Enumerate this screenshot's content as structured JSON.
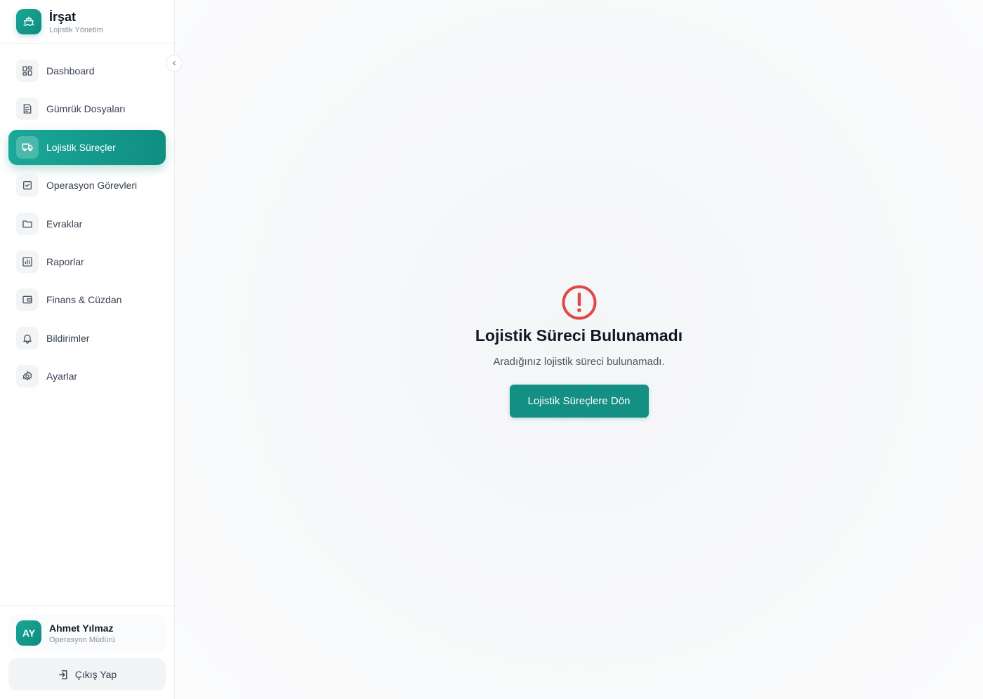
{
  "brand": {
    "name": "İrşat",
    "subtitle": "Lojistik Yönetim",
    "logo_icon": "ship-icon"
  },
  "sidebar": {
    "collapse_icon": "chevron-left-icon",
    "items": [
      {
        "label": "Dashboard",
        "icon": "grid-icon",
        "active": false
      },
      {
        "label": "Gümrük Dosyaları",
        "icon": "document-icon",
        "active": false
      },
      {
        "label": "Lojistik Süreçler",
        "icon": "truck-icon",
        "active": true
      },
      {
        "label": "Operasyon Görevleri",
        "icon": "checkbox-icon",
        "active": false
      },
      {
        "label": "Evraklar",
        "icon": "folder-icon",
        "active": false
      },
      {
        "label": "Raporlar",
        "icon": "bar-chart-icon",
        "active": false
      },
      {
        "label": "Finans & Cüzdan",
        "icon": "wallet-icon",
        "active": false
      },
      {
        "label": "Bildirimler",
        "icon": "bell-icon",
        "active": false
      },
      {
        "label": "Ayarlar",
        "icon": "gear-icon",
        "active": false
      }
    ]
  },
  "user": {
    "initials": "AY",
    "name": "Ahmet Yılmaz",
    "role": "Operasyon Müdürü"
  },
  "logout": {
    "label": "Çıkış Yap",
    "icon": "logout-icon"
  },
  "error": {
    "icon": "alert-circle-icon",
    "title": "Lojistik Süreci Bulunamadı",
    "description": "Aradığınız lojistik süreci bulunamadı.",
    "button_label": "Lojistik Süreçlere Dön"
  },
  "colors": {
    "accent": "#148f84",
    "accent_light": "#1ba898",
    "error": "#e04848"
  }
}
